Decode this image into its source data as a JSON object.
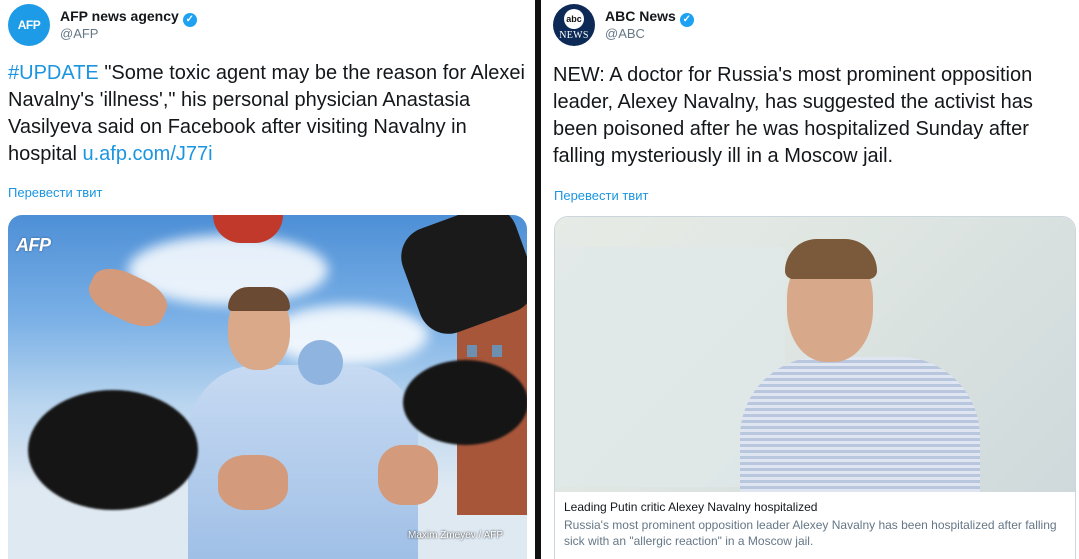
{
  "left_tweet": {
    "author_name": "AFP news agency",
    "author_handle": "@AFP",
    "avatar_label": "AFP",
    "text_hashtag": "#UPDATE",
    "text_body": " \"Some toxic agent may be the reason for Alexei Navalny's 'illness',\" his personal physician Anastasia Vasilyeva said on Facebook after visiting Navalny in hospital ",
    "text_link": "u.afp.com/J77i",
    "translate_label": "Перевести твит",
    "photo_logo": "AFP",
    "photo_credit": "Maxim Zmeyev / AFP"
  },
  "right_tweet": {
    "author_name": "ABC News",
    "author_handle": "@ABC",
    "avatar_disc": "abc",
    "avatar_word": "NEWS",
    "text_body": "NEW: A doctor for Russia's most prominent opposition leader, Alexey Navalny, has suggested the activist has been poisoned after he was hospitalized Sunday after falling mysteriously ill in a Moscow jail.",
    "translate_label": "Перевести твит",
    "card": {
      "title": "Leading Putin critic Alexey Navalny hospitalized",
      "description": "Russia's most prominent opposition leader Alexey Navalny has been hospitalized after falling sick with an \"allergic reaction\" in a Moscow jail."
    }
  },
  "colors": {
    "link": "#1b95e0",
    "verified": "#1da1f2",
    "abc_navy": "#0d2a57"
  },
  "icons": {
    "verified": "verified-badge-icon"
  }
}
